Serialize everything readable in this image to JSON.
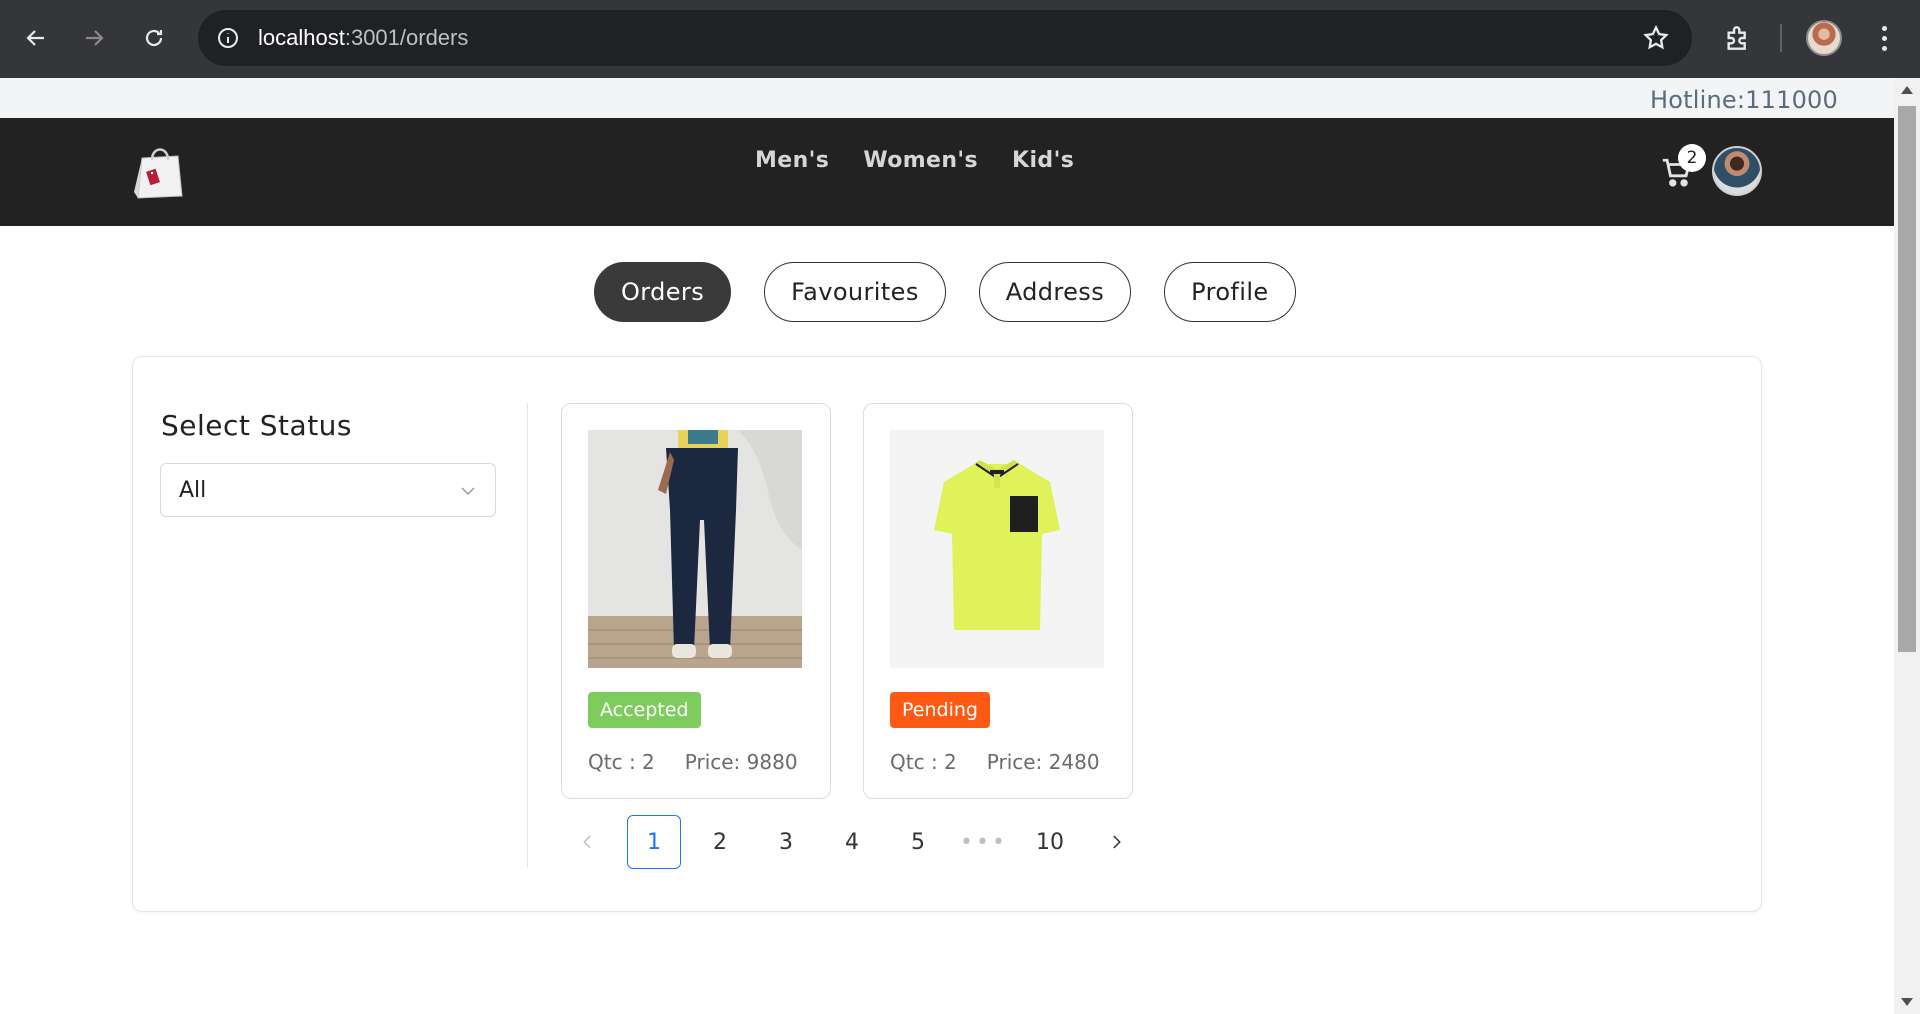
{
  "browser": {
    "url_host": "localhost",
    "url_rest": ":3001/orders"
  },
  "topstrip": {
    "hotline": "Hotline:111000"
  },
  "navbar": {
    "links": [
      "Men's",
      "Women's",
      "Kid's"
    ],
    "cart_count": "2"
  },
  "tabs": [
    {
      "label": "Orders",
      "active": true
    },
    {
      "label": "Favourites",
      "active": false
    },
    {
      "label": "Address",
      "active": false
    },
    {
      "label": "Profile",
      "active": false
    }
  ],
  "filter": {
    "title": "Select Status",
    "selected": "All"
  },
  "orders": [
    {
      "status": "Accepted",
      "status_color": "#7ccc5e",
      "qty_label": "Qtc : 2",
      "price_label": "Price: 9880",
      "image": "jeans"
    },
    {
      "status": "Pending",
      "status_color": "#ff5a14",
      "qty_label": "Qtc : 2",
      "price_label": "Price: 2480",
      "image": "polo-shirt"
    }
  ],
  "pagination": {
    "pages": [
      "1",
      "2",
      "3",
      "4",
      "5"
    ],
    "ellipsis": "•••",
    "last": "10",
    "current": "1"
  },
  "colors": {
    "navbar_bg": "#222222",
    "active_tab_bg": "#3a3a3a",
    "pager_active": "#1677ff"
  }
}
